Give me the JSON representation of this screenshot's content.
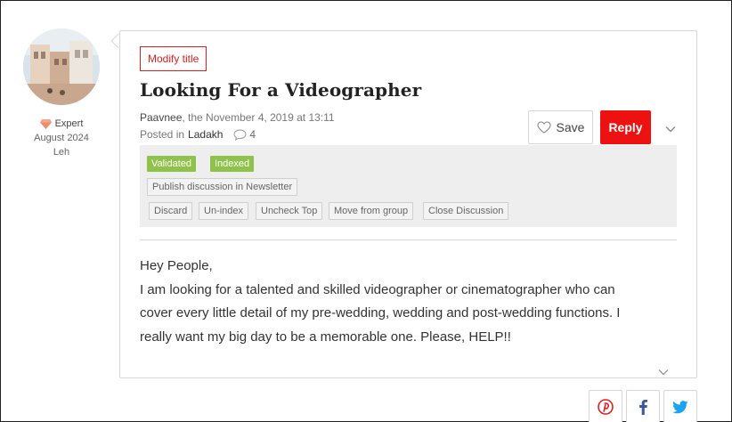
{
  "author": {
    "badge_label": "Expert",
    "joined": "August 2024",
    "location": "Leh"
  },
  "post": {
    "modify_title_label": "Modify title",
    "title": "Looking For a Videographer",
    "author_name": "Paavnee",
    "date_text": ", the November 4, 2019 at 13:11",
    "posted_in_label": "Posted in",
    "group": "Ladakh",
    "comment_count": "4",
    "body_lines": [
      "Hey People,",
      "I am looking for a talented and skilled videographer or cinematographer who can",
      "cover every little detail of my pre-wedding, wedding and post-wedding functions. I",
      "really want my big day to be a memorable one. Please, HELP!!"
    ]
  },
  "actions": {
    "save_label": "Save",
    "reply_label": "Reply"
  },
  "moderation": {
    "tags": [
      "Validated",
      "Indexed"
    ],
    "publish_label": "Publish discussion in Newsletter",
    "buttons": [
      "Discard",
      "Un-index",
      "Uncheck Top",
      "Move from group",
      "Close Discussion"
    ]
  },
  "share": {
    "icons": [
      "pinterest-icon",
      "facebook-icon",
      "twitter-icon"
    ]
  },
  "colors": {
    "accent_red": "#ee1111",
    "tag_green": "#8fc24b",
    "facebook_blue": "#3b5998",
    "twitter_blue": "#1da1f2"
  }
}
